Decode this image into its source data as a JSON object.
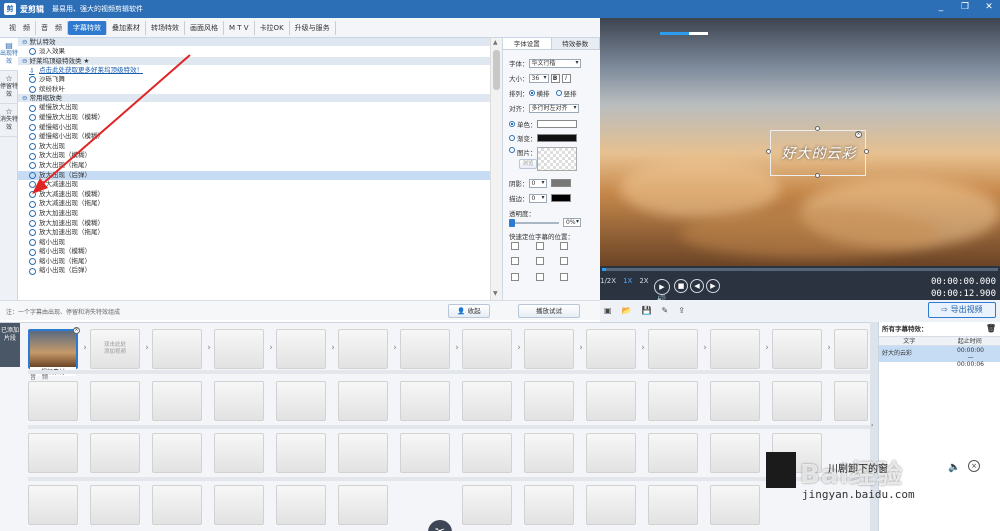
{
  "app": {
    "name": "爱剪辑",
    "slogan": "最易用、强大的视频剪辑软件",
    "icon_glyph": "剪"
  },
  "window": {
    "controls": [
      "_",
      "❐",
      "✕"
    ]
  },
  "menu_tabs": [
    "视　频",
    "音　频",
    "字幕特效",
    "叠加素材",
    "转场特效",
    "画面风格",
    "M T V",
    "卡拉OK",
    "升级与服务"
  ],
  "active_menu": "字幕特效",
  "vertical_tabs": [
    {
      "label": "出现特效",
      "icon": "text-appear-icon",
      "active": true
    },
    {
      "label": "停留特效",
      "icon": "star-icon",
      "active": false
    },
    {
      "label": "消失特效",
      "icon": "star-outline-icon",
      "active": false
    }
  ],
  "effects": {
    "groups": [
      {
        "title": "默认特效",
        "items": [
          {
            "label": "淡入效果"
          }
        ]
      },
      {
        "title": "好莱坞顶级特效类 ★",
        "items": [
          {
            "label": "点击此处获取更多好莱坞顶级特效！",
            "link": true
          },
          {
            "label": "沙砾飞舞"
          },
          {
            "label": "缤纷秋叶"
          }
        ]
      },
      {
        "title": "常用缩放类",
        "items": [
          {
            "label": "缓慢放大出现"
          },
          {
            "label": "缓慢放大出现（模糊）"
          },
          {
            "label": "缓慢缩小出现"
          },
          {
            "label": "缓慢缩小出现（模糊）"
          },
          {
            "label": "放大出现"
          },
          {
            "label": "放大出现（模糊）"
          },
          {
            "label": "放大出现（拖尾）"
          },
          {
            "label": "放大出现（后弹）",
            "selected": true
          },
          {
            "label": "放大减速出现"
          },
          {
            "label": "放大减速出现（模糊）"
          },
          {
            "label": "放大减速出现（拖尾）"
          },
          {
            "label": "放大加速出现"
          },
          {
            "label": "放大加速出现（模糊）"
          },
          {
            "label": "放大加速出现（拖尾）"
          },
          {
            "label": "缩小出现"
          },
          {
            "label": "缩小出现（模糊）"
          },
          {
            "label": "缩小出现（拖尾）"
          },
          {
            "label": "缩小出现（后弹）"
          }
        ]
      }
    ]
  },
  "note": "注：一个字幕由出现、停留和消失特效组成",
  "buttons": {
    "collapse": "收起",
    "preview": "播放试试",
    "export": "导出视频"
  },
  "settings": {
    "tabs": [
      "字体设置",
      "特效参数"
    ],
    "font_label": "字体：",
    "font_value": "华文行楷",
    "size_label": "大小：",
    "size_value": "36",
    "bold": "B",
    "italic": "I",
    "arrange_label": "排列：",
    "arrange_options": [
      "横排",
      "竖排"
    ],
    "align_label": "对齐：",
    "align_value": "多行时左对齐",
    "mono_label": "单色：",
    "gradient_label": "渐变：",
    "image_label": "图片：",
    "browse": "浏览",
    "shadow_label": "阴影：",
    "shadow_value": "0",
    "border_label": "描边：",
    "border_value": "0",
    "opacity_label": "透明度：",
    "opacity_value": "0%",
    "position_label": "快速定位字幕的位置："
  },
  "preview": {
    "caption": "好大的云彩"
  },
  "player": {
    "speeds": [
      "1/2X",
      "1X",
      "2X"
    ],
    "active_speed": "1X",
    "current_time": "00:00:00.000",
    "total_time": "00:00:12.900"
  },
  "timeline": {
    "side_label": "已添加片段",
    "clips": [
      {
        "label": "视频素材"
      },
      {
        "add_text": "双击此处\n添加视频"
      }
    ],
    "audio_label": "音　频"
  },
  "subtitle_list": {
    "title": "所有字幕特效：",
    "columns": [
      "文字",
      "起止时间"
    ],
    "rows": [
      {
        "text": "好大的云彩",
        "start": "00:00:00",
        "end": "00:00:06"
      }
    ]
  },
  "watermark": {
    "brand": "Bai经验",
    "url": "jingyan.baidu.com",
    "popup": "川剧卸下的窗"
  }
}
